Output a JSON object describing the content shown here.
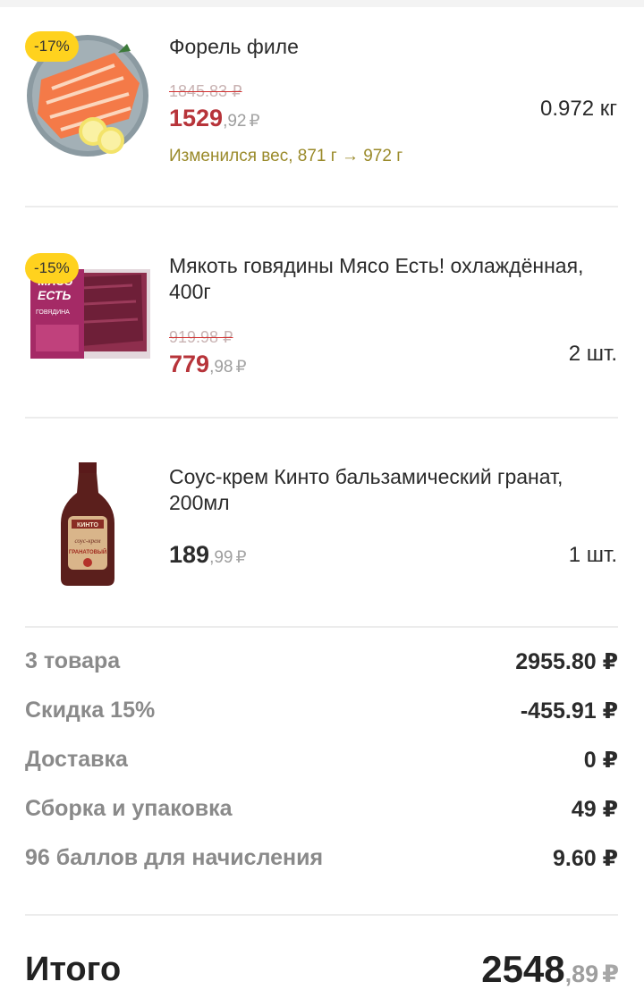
{
  "items": [
    {
      "title": "Форель филе",
      "badge": "-17%",
      "old_price": "1845.83 ₽",
      "price_int": "1529",
      "price_frac": ",92",
      "currency": "₽",
      "note": "Изменился вес, 871 г → 972 г",
      "qty": "0.972 кг",
      "image": "trout-fillet-image"
    },
    {
      "title": "Мякоть говядины Мясо Есть! охлаждённая, 400г",
      "badge": "-15%",
      "old_price": "919.98 ₽",
      "price_int": "779",
      "price_frac": ",98",
      "currency": "₽",
      "qty": "2 шт.",
      "image": "beef-pack-image",
      "package_text": [
        "МЯСО",
        "ЕСТЬ",
        "ГОВЯДИНА"
      ]
    },
    {
      "title": "Соус-крем Кинто бальзамический гранат, 200мл",
      "price_int": "189",
      "price_frac": ",99",
      "currency": "₽",
      "qty": "1 шт.",
      "image": "sauce-bottle-image",
      "package_text": [
        "КИНТО",
        "соус-крем",
        "ГРАНАТОВЫЙ"
      ]
    }
  ],
  "summary": [
    {
      "label": "3 товара",
      "value": "2955.80 ₽"
    },
    {
      "label": "Скидка 15%",
      "value": "-455.91 ₽"
    },
    {
      "label": "Доставка",
      "value": "0 ₽"
    },
    {
      "label": "Сборка и упаковка",
      "value": "49 ₽"
    },
    {
      "label": "96 баллов для начисления",
      "value": "9.60 ₽"
    }
  ],
  "total": {
    "label": "Итого",
    "int": "2548",
    "frac": ",89",
    "currency": "₽"
  },
  "colors": {
    "badge": "#ffd21e",
    "discount_price": "#b7343a",
    "note": "#9a8a2a"
  }
}
